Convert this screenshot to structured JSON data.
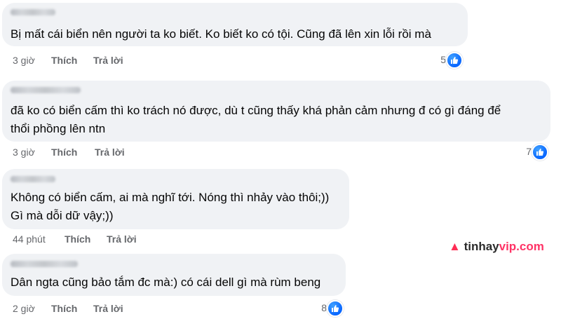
{
  "comments": [
    {
      "text_lines": [
        "Bị mất cái biển nên người ta ko biết. Ko biết ko có tội. Cũng đã lên xin lỗi rồi mà"
      ],
      "time": "3 giờ",
      "like_label": "Thích",
      "reply_label": "Trả lời",
      "reactions": "5"
    },
    {
      "text_lines": [
        "đã ko có biển cấm thì ko trách nó được, dù t cũng thấy khá phản cảm nhưng đ có gì đáng để",
        "thổi phồng lên ntn"
      ],
      "time": "3 giờ",
      "like_label": "Thích",
      "reply_label": "Trả lời",
      "reactions": "7"
    },
    {
      "text_lines": [
        "Không có biển cấm, ai mà nghĩ tới. Nóng thì nhảy vào thôi;))",
        "Gì mà dỗi dữ vậy;))"
      ],
      "time": "44 phút",
      "like_label": "Thích",
      "reply_label": "Trả lời"
    },
    {
      "text_lines": [
        "Dân ngta cũng bảo tắm đc mà:) có cái dell gì mà rùm beng"
      ],
      "time": "2 giờ",
      "like_label": "Thích",
      "reply_label": "Trả lời",
      "reactions": "8"
    }
  ],
  "watermark": {
    "part1": "tinhay",
    "part2": "vip.com",
    "icon": "flame-icon"
  },
  "colors": {
    "bubble": "#f0f2f5",
    "meta": "#65676b",
    "like_blue": "#0866ff"
  }
}
